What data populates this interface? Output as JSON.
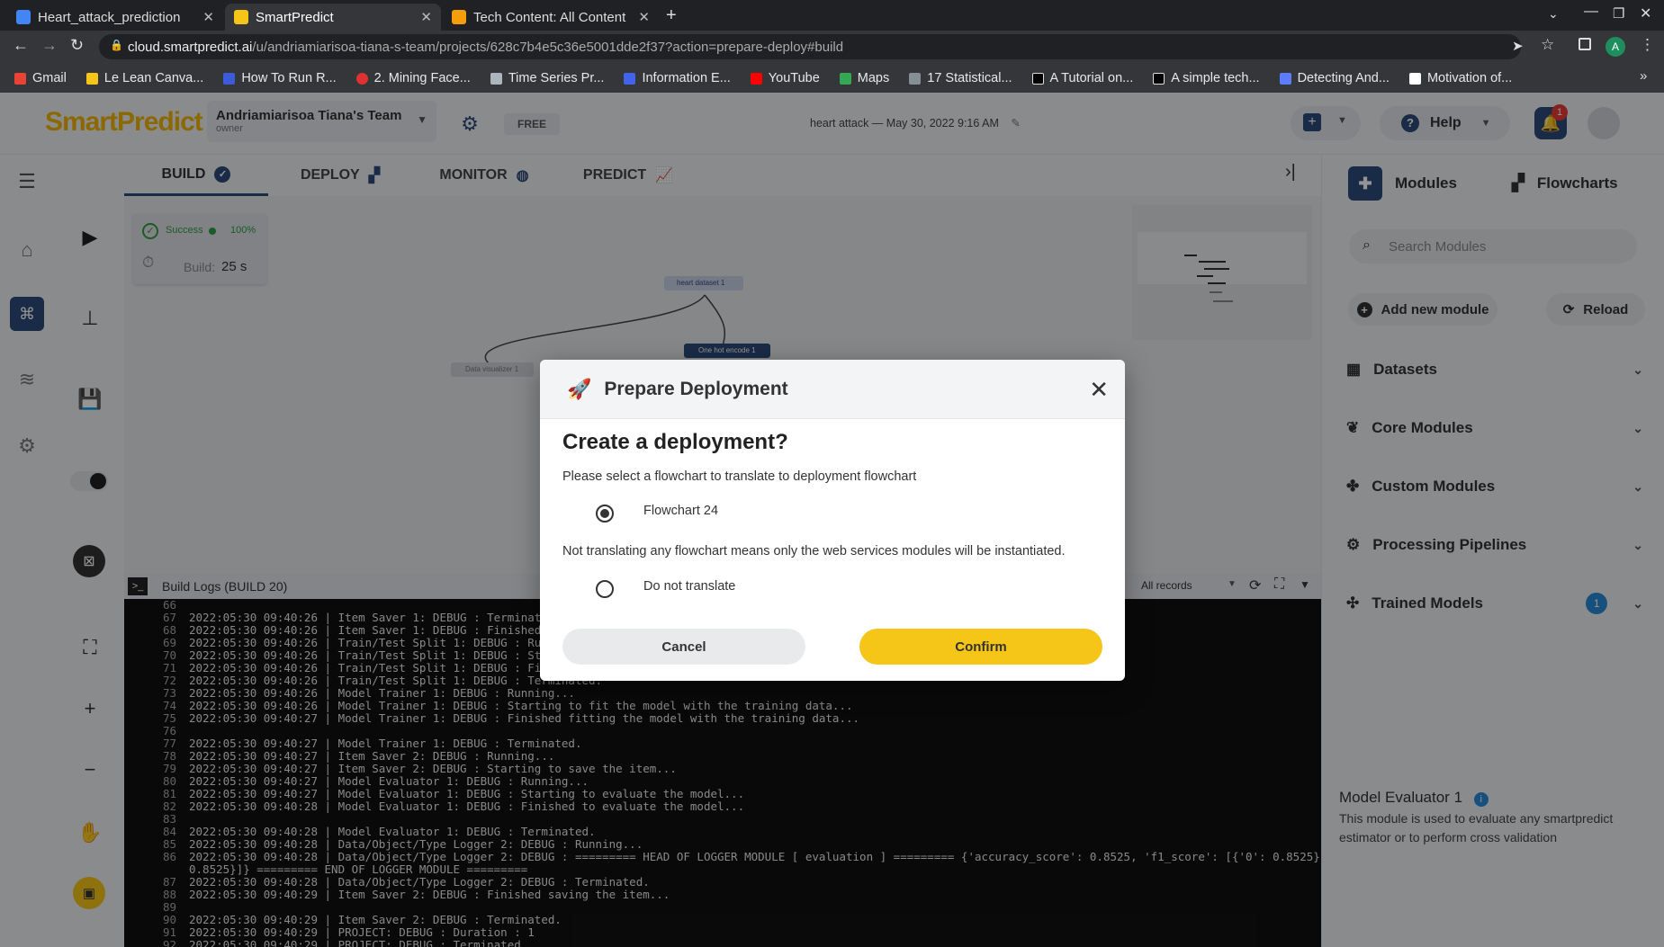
{
  "browser": {
    "tabs": [
      {
        "title": "Heart_attack_prediction",
        "favicon_color": "#4285f4"
      },
      {
        "title": "SmartPredict",
        "favicon_color": "#f5c518"
      },
      {
        "title": "Tech Content: All Content",
        "favicon_color": "#f59e0b"
      }
    ],
    "url_host": "cloud.smartpredict.ai",
    "url_path": "/u/andriamiarisoa-tiana-s-team/projects/628c7b4e5c36e5001dde2f37?action=prepare-deploy#build",
    "profile_initial": "A",
    "bookmarks": [
      "Gmail",
      "Le Lean Canva...",
      "How To Run R...",
      "2. Mining Face...",
      "Time Series Pr...",
      "Information E...",
      "YouTube",
      "Maps",
      "17 Statistical...",
      "A Tutorial on...",
      "A simple tech...",
      "Detecting And...",
      "Motivation of..."
    ]
  },
  "header": {
    "logo": "SmartPredict",
    "team_name": "Andriamiarisoa Tiana's Team",
    "team_role": "owner",
    "plan": "FREE",
    "project": "heart attack",
    "project_date": "May 30, 2022 9:16 AM",
    "help": "Help",
    "notifications": "1"
  },
  "tabs": [
    "BUILD",
    "DEPLOY",
    "MONITOR",
    "PREDICT"
  ],
  "canvas": {
    "status": "Success",
    "status_pct": "100%",
    "build_label": "Build:",
    "build_time": "25 s",
    "nodes": [
      "heart dataset 1",
      "One hot encode 1",
      "Data visualizer 1"
    ]
  },
  "logs": {
    "title": "Build Logs (BUILD 20)",
    "filter": "All records",
    "lines": [
      {
        "n": "66",
        "t": "",
        "blue": true
      },
      {
        "n": "67",
        "t": "2022:05:30 09:40:26 | Item Saver 1: DEBUG : Terminated."
      },
      {
        "n": "68",
        "t": "2022:05:30 09:40:26 | Item Saver 1: DEBUG : Finished saving the item..."
      },
      {
        "n": "69",
        "t": "2022:05:30 09:40:26 | Train/Test Split 1: DEBUG : Running..."
      },
      {
        "n": "70",
        "t": "2022:05:30 09:40:26 | Train/Test Split 1: DEBUG : Starting..."
      },
      {
        "n": "71",
        "t": "2022:05:30 09:40:26 | Train/Test Split 1: DEBUG : Finished..."
      },
      {
        "n": "72",
        "t": "2022:05:30 09:40:26 | Train/Test Split 1: DEBUG : Terminated."
      },
      {
        "n": "73",
        "t": "2022:05:30 09:40:26 | Model Trainer 1: DEBUG : Running..."
      },
      {
        "n": "74",
        "t": "2022:05:30 09:40:26 | Model Trainer 1: DEBUG : Starting to fit the model with the training data..."
      },
      {
        "n": "75",
        "t": "2022:05:30 09:40:27 | Model Trainer 1: DEBUG : Finished fitting the model with the training data..."
      },
      {
        "n": "76",
        "t": "",
        "blue": true
      },
      {
        "n": "77",
        "t": "2022:05:30 09:40:27 | Model Trainer 1: DEBUG : Terminated."
      },
      {
        "n": "78",
        "t": "2022:05:30 09:40:27 | Item Saver 2: DEBUG : Running..."
      },
      {
        "n": "79",
        "t": "2022:05:30 09:40:27 | Item Saver 2: DEBUG : Starting to save the item..."
      },
      {
        "n": "80",
        "t": "2022:05:30 09:40:27 | Model Evaluator 1: DEBUG : Running..."
      },
      {
        "n": "81",
        "t": "2022:05:30 09:40:27 | Model Evaluator 1: DEBUG : Starting to evaluate the model..."
      },
      {
        "n": "82",
        "t": "2022:05:30 09:40:28 | Model Evaluator 1: DEBUG : Finished to evaluate the model..."
      },
      {
        "n": "83",
        "t": "",
        "blue": true
      },
      {
        "n": "84",
        "t": "2022:05:30 09:40:28 | Model Evaluator 1: DEBUG : Terminated."
      },
      {
        "n": "85",
        "t": "2022:05:30 09:40:28 | Data/Object/Type Logger 2: DEBUG : Running..."
      },
      {
        "n": "86",
        "t": "2022:05:30 09:40:28 | Data/Object/Type Logger 2: DEBUG : ========= HEAD OF LOGGER MODULE [ evaluation ] ========= {'accuracy_score': 0.8525, 'f1_score': [{'0': 0.8525}, {'1':"
      },
      {
        "n": "",
        "t": "0.8525}]} ========= END OF LOGGER MODULE ========="
      },
      {
        "n": "87",
        "t": "2022:05:30 09:40:28 | Data/Object/Type Logger 2: DEBUG : Terminated."
      },
      {
        "n": "88",
        "t": "2022:05:30 09:40:29 | Item Saver 2: DEBUG : Finished saving the item..."
      },
      {
        "n": "89",
        "t": "",
        "blue": true
      },
      {
        "n": "90",
        "t": "2022:05:30 09:40:29 | Item Saver 2: DEBUG : Terminated."
      },
      {
        "n": "91",
        "t": "2022:05:30 09:40:29 | PROJECT: DEBUG : Duration : 1"
      },
      {
        "n": "92",
        "t": "2022:05:30 09:40:29 | PROJECT: DEBUG : Terminated."
      }
    ]
  },
  "right_panel": {
    "tab_modules": "Modules",
    "tab_flowcharts": "Flowcharts",
    "search_placeholder": "Search Modules",
    "add_module": "Add new module",
    "reload": "Reload",
    "categories": [
      "Datasets",
      "Core Modules",
      "Custom Modules",
      "Processing Pipelines",
      "Trained Models"
    ],
    "trained_models_count": "1",
    "module_title": "Model Evaluator 1",
    "module_desc": "This module is used to evaluate any smartpredict estimator or to perform cross validation"
  },
  "modal": {
    "title": "Prepare Deployment",
    "question": "Create a deployment?",
    "instruction": "Please select a flowchart to translate to deployment flowchart",
    "option1": "Flowchart 24",
    "note": "Not translating any flowchart means only the web services modules will be instantiated.",
    "option2": "Do not translate",
    "cancel": "Cancel",
    "confirm": "Confirm"
  }
}
